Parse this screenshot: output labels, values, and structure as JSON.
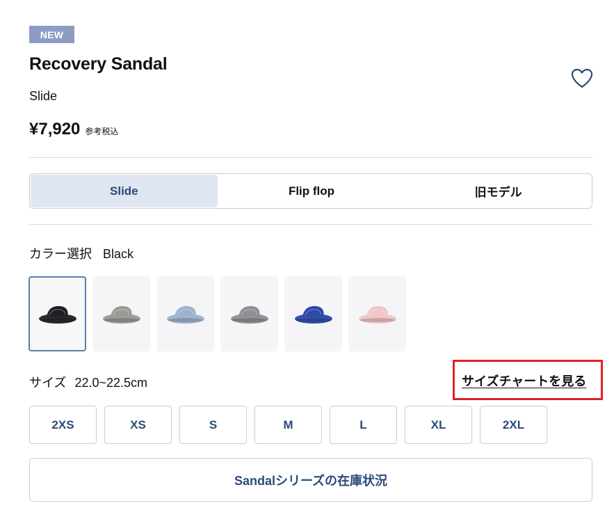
{
  "product": {
    "badge": "NEW",
    "name": "Recovery Sandal",
    "subtitle": "Slide",
    "price": "¥7,920",
    "tax_note": "参考税込"
  },
  "model_tabs": [
    {
      "label": "Slide",
      "active": true
    },
    {
      "label": "Flip flop",
      "active": false
    },
    {
      "label": "旧モデル",
      "active": false
    }
  ],
  "color": {
    "label": "カラー選択",
    "selected": "Black",
    "swatches": [
      {
        "icon": "sandal-black",
        "color": "#1d1f22",
        "selected": true
      },
      {
        "icon": "sandal-gray-beige",
        "color": "#9a9a92",
        "selected": false
      },
      {
        "icon": "sandal-light-blue",
        "color": "#9cb3cf",
        "selected": false
      },
      {
        "icon": "sandal-gray",
        "color": "#8d8f92",
        "selected": false
      },
      {
        "icon": "sandal-blue",
        "color": "#2a49a8",
        "selected": false
      },
      {
        "icon": "sandal-pink",
        "color": "#f0c6c8",
        "selected": false
      }
    ]
  },
  "size": {
    "label": "サイズ",
    "selected_range": "22.0~22.5cm",
    "chart_link": "サイズチャートを見る",
    "options": [
      "2XS",
      "XS",
      "S",
      "M",
      "L",
      "XL",
      "2XL"
    ]
  },
  "stock_button": "Sandalシリーズの在庫状況",
  "colors": {
    "accent": "#2b4a7a",
    "badge_bg": "#8e9cc4",
    "active_tab_bg": "#dfe6f1",
    "highlight_box": "#e0202a"
  }
}
